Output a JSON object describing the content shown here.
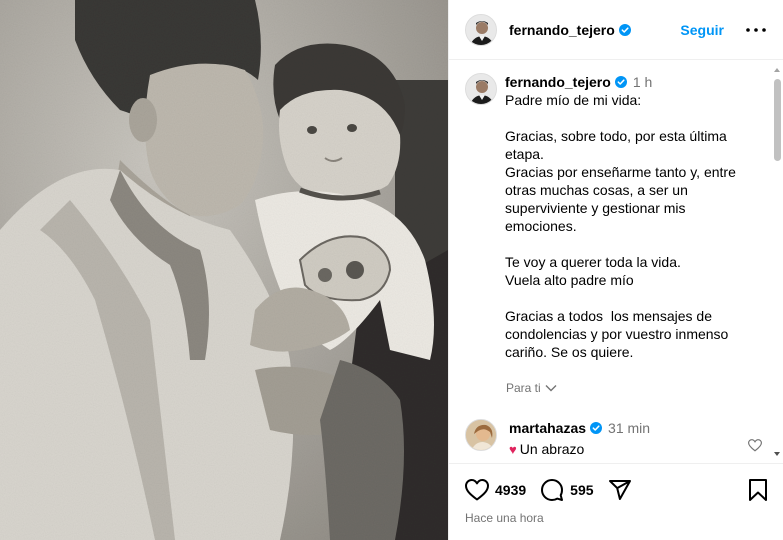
{
  "post": {
    "username": "fernando_tejero",
    "follow_label": "Seguir",
    "more_label": "•••"
  },
  "caption": {
    "username": "fernando_tejero",
    "time": "1 h",
    "text": "Padre mío de mi vida:\n\nGracias, sobre todo, por esta última etapa.\nGracias por enseñarme tanto y, entre otras muchas cosas, a ser un superviviente y gestionar mis emociones.\n\nTe voy a querer toda la vida.\nVuela alto padre mío\n\nGracias a todos  los mensajes de condolencias y por vuestro inmenso cariño. Se os quiere.",
    "translate_label": "Para ti"
  },
  "comment": {
    "username": "martahazas",
    "time": "31 min",
    "emoji": "♥",
    "text": "Un abrazo"
  },
  "actions": {
    "likes": "4939",
    "comments": "595",
    "timestamp": "Hace una hora"
  },
  "icons": {
    "verified": "verified-badge-icon",
    "more": "more-options-icon",
    "like": "heart-icon",
    "comment": "comment-bubble-icon",
    "share": "send-icon",
    "save": "bookmark-icon",
    "translate": "chevron-down-icon"
  },
  "colors": {
    "accent": "#0095f6",
    "secondary_text": "#737373",
    "divider": "#efefef",
    "heart_emoji": "#e0245e"
  }
}
